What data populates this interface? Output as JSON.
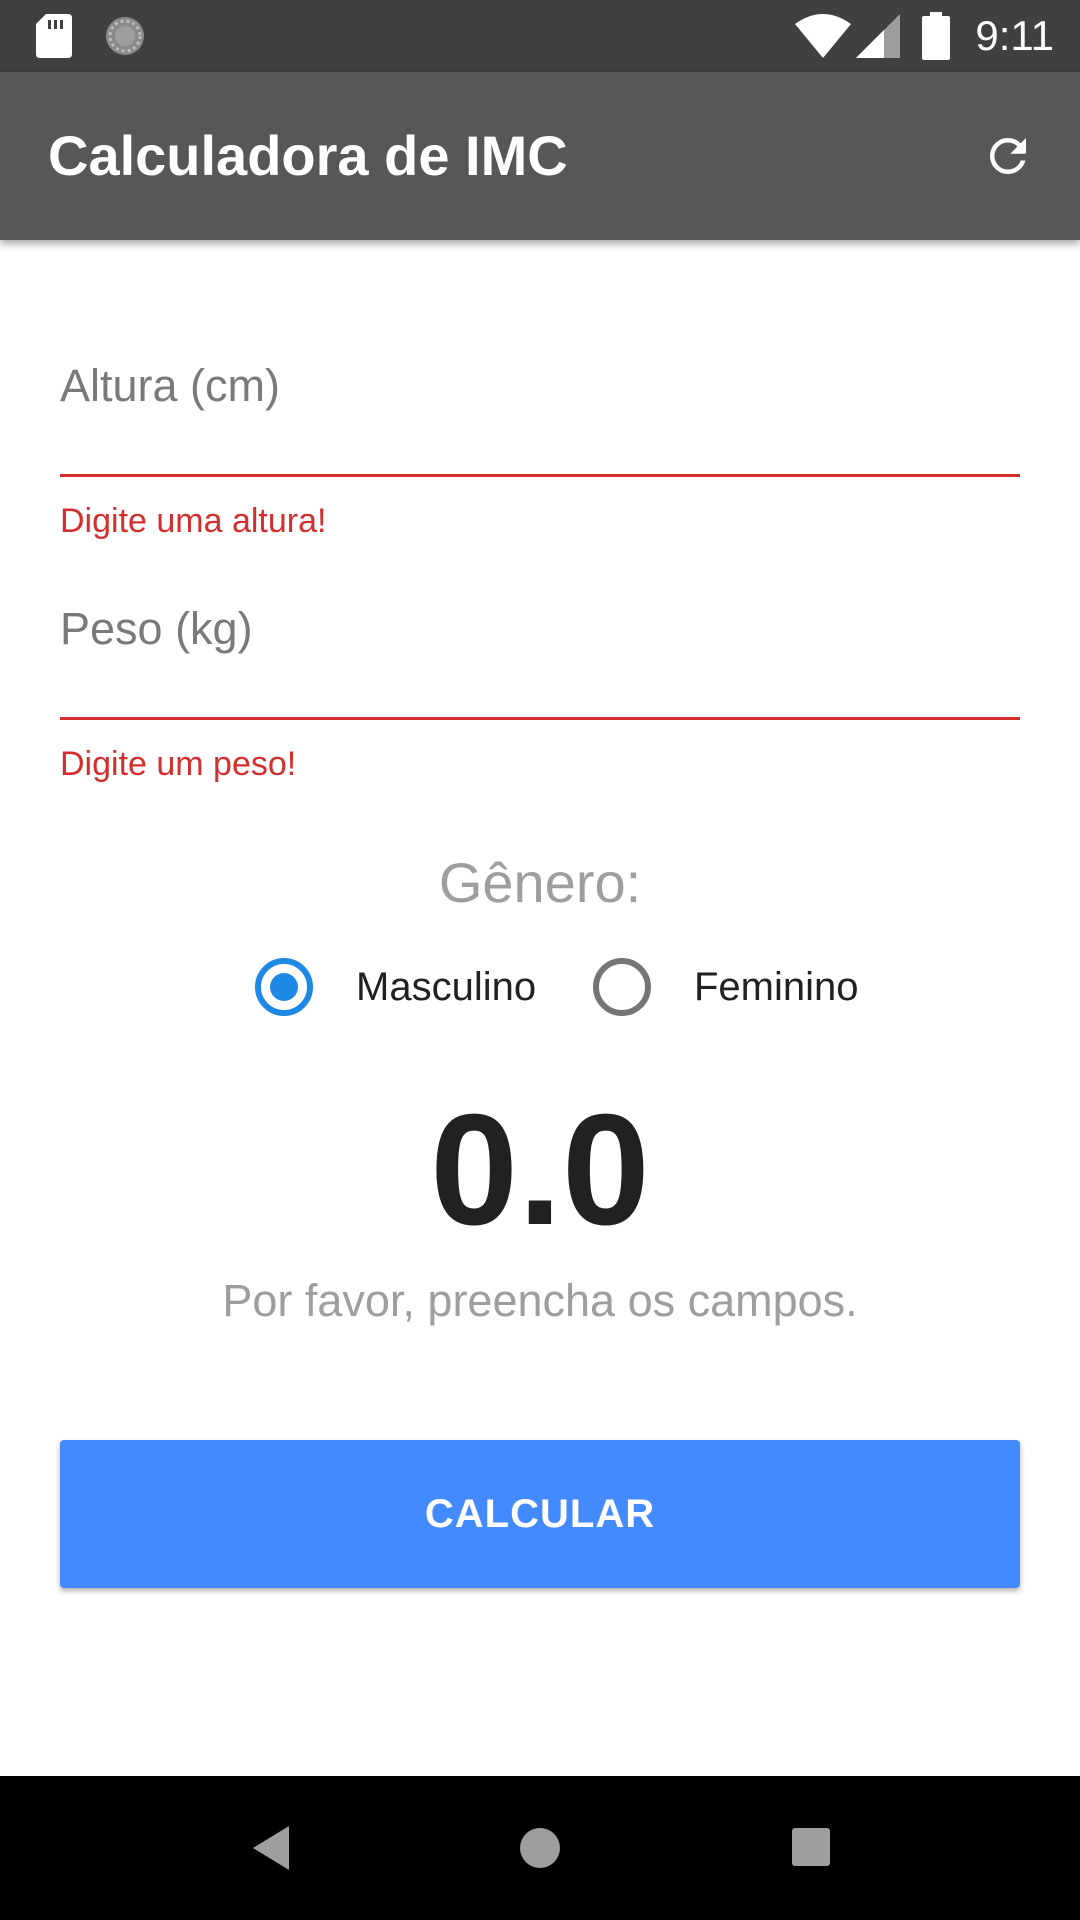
{
  "status_bar": {
    "time": "9:11",
    "icons": [
      "sd-card-icon",
      "sync-icon",
      "wifi-icon",
      "cell-signal-icon",
      "battery-icon"
    ]
  },
  "app_bar": {
    "title": "Calculadora de IMC",
    "refresh_icon": "refresh-icon"
  },
  "form": {
    "height": {
      "placeholder": "Altura (cm)",
      "value": "",
      "error": "Digite uma altura!"
    },
    "weight": {
      "placeholder": "Peso (kg)",
      "value": "",
      "error": "Digite um peso!"
    }
  },
  "gender": {
    "label": "Gênero:",
    "options": [
      {
        "label": "Masculino",
        "selected": true
      },
      {
        "label": "Feminino",
        "selected": false
      }
    ]
  },
  "result": {
    "value": "0.0",
    "message": "Por favor, preencha os campos."
  },
  "calculate_button": {
    "label": "CALCULAR"
  },
  "nav_bar": {
    "icons": [
      "back-icon",
      "home-icon",
      "recents-icon"
    ]
  },
  "colors": {
    "app_bar": "#575757",
    "status_bar": "#404040",
    "error": "#d32f2f",
    "radio_selected": "#1e88e5",
    "button": "#448aff"
  }
}
